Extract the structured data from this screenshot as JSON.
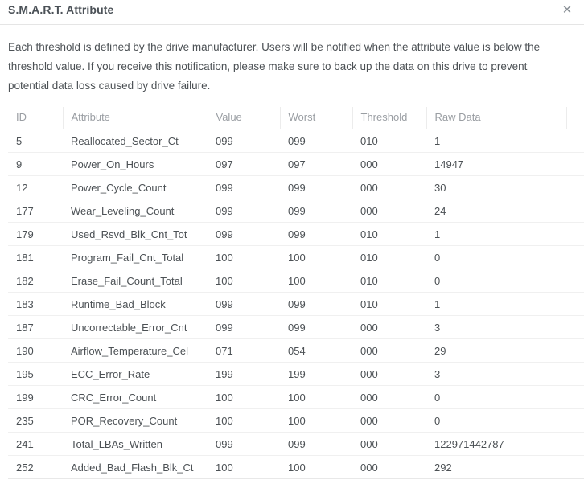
{
  "dialog": {
    "title": "S.M.A.R.T. Attribute",
    "close_icon": "close-icon",
    "close_glyph": "✕",
    "description": "Each threshold is defined by the drive manufacturer. Users will be notified when the attribute value is below the threshold value. If you receive this notification, please make sure to back up the data on this drive to prevent potential data loss caused by drive failure."
  },
  "table": {
    "columns": [
      {
        "key": "id",
        "label": "ID"
      },
      {
        "key": "attribute",
        "label": "Attribute"
      },
      {
        "key": "value",
        "label": "Value"
      },
      {
        "key": "worst",
        "label": "Worst"
      },
      {
        "key": "threshold",
        "label": "Threshold"
      },
      {
        "key": "raw_data",
        "label": "Raw Data"
      },
      {
        "key": "spacer",
        "label": ""
      }
    ],
    "rows": [
      {
        "id": "5",
        "attribute": "Reallocated_Sector_Ct",
        "value": "099",
        "worst": "099",
        "threshold": "010",
        "raw_data": "1"
      },
      {
        "id": "9",
        "attribute": "Power_On_Hours",
        "value": "097",
        "worst": "097",
        "threshold": "000",
        "raw_data": "14947"
      },
      {
        "id": "12",
        "attribute": "Power_Cycle_Count",
        "value": "099",
        "worst": "099",
        "threshold": "000",
        "raw_data": "30"
      },
      {
        "id": "177",
        "attribute": "Wear_Leveling_Count",
        "value": "099",
        "worst": "099",
        "threshold": "000",
        "raw_data": "24"
      },
      {
        "id": "179",
        "attribute": "Used_Rsvd_Blk_Cnt_Tot",
        "value": "099",
        "worst": "099",
        "threshold": "010",
        "raw_data": "1"
      },
      {
        "id": "181",
        "attribute": "Program_Fail_Cnt_Total",
        "value": "100",
        "worst": "100",
        "threshold": "010",
        "raw_data": "0"
      },
      {
        "id": "182",
        "attribute": "Erase_Fail_Count_Total",
        "value": "100",
        "worst": "100",
        "threshold": "010",
        "raw_data": "0"
      },
      {
        "id": "183",
        "attribute": "Runtime_Bad_Block",
        "value": "099",
        "worst": "099",
        "threshold": "010",
        "raw_data": "1"
      },
      {
        "id": "187",
        "attribute": "Uncorrectable_Error_Cnt",
        "value": "099",
        "worst": "099",
        "threshold": "000",
        "raw_data": "3"
      },
      {
        "id": "190",
        "attribute": "Airflow_Temperature_Cel",
        "value": "071",
        "worst": "054",
        "threshold": "000",
        "raw_data": "29"
      },
      {
        "id": "195",
        "attribute": "ECC_Error_Rate",
        "value": "199",
        "worst": "199",
        "threshold": "000",
        "raw_data": "3"
      },
      {
        "id": "199",
        "attribute": "CRC_Error_Count",
        "value": "100",
        "worst": "100",
        "threshold": "000",
        "raw_data": "0"
      },
      {
        "id": "235",
        "attribute": "POR_Recovery_Count",
        "value": "100",
        "worst": "100",
        "threshold": "000",
        "raw_data": "0"
      },
      {
        "id": "241",
        "attribute": "Total_LBAs_Written",
        "value": "099",
        "worst": "099",
        "threshold": "000",
        "raw_data": "122971442787"
      },
      {
        "id": "252",
        "attribute": "Added_Bad_Flash_Blk_Ct",
        "value": "100",
        "worst": "100",
        "threshold": "000",
        "raw_data": "292"
      }
    ]
  },
  "colors": {
    "title_text": "#4b5157",
    "body_text": "#4c5155",
    "header_text": "#9a9ea3",
    "border": "#e8e8e8",
    "row_border": "#f0f0f0",
    "background": "#ffffff"
  }
}
